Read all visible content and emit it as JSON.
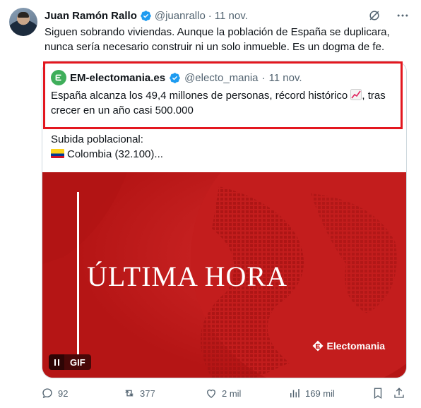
{
  "author": {
    "name": "Juan Ramón Rallo",
    "handle": "@juanrallo",
    "separator": "·",
    "date": "11 nov."
  },
  "tweet": {
    "line1": "Siguen sobrando viviendas. Aunque la población de España se duplicara,",
    "line2": "nunca sería necesario construir ni un solo inmueble. Es un dogma de fe."
  },
  "quoted": {
    "name": "EM-electomania.es",
    "handle": "@electo_mania",
    "separator": "·",
    "date": "11 nov.",
    "line1_before_emoji": "España alcanza los 49,4 millones de personas, récord histórico ",
    "line1_after_emoji": ", tras",
    "line2": "crecer en un año casi 500.000",
    "sub_line1": "Subida poblacional:",
    "sub_line2": "Colombia (32.100)...",
    "media": {
      "headline": "ÚLTIMA HORA",
      "brand": "Electomania",
      "gif_label": "GIF"
    }
  },
  "actions": {
    "replies": "92",
    "reposts": "377",
    "likes": "2 mil",
    "views": "169 mil"
  },
  "colors": {
    "accent": "#1d9bf0",
    "highlight_border": "#e3171f",
    "media_bg": "#c61a1a",
    "muted_text": "#536471"
  },
  "icons": [
    "verified-badge-icon",
    "grok-icon",
    "more-icon",
    "reply-icon",
    "repost-icon",
    "like-icon",
    "views-icon",
    "bookmark-icon",
    "share-icon",
    "pause-icon",
    "chart-increasing-icon",
    "colombia-flag-icon"
  ]
}
